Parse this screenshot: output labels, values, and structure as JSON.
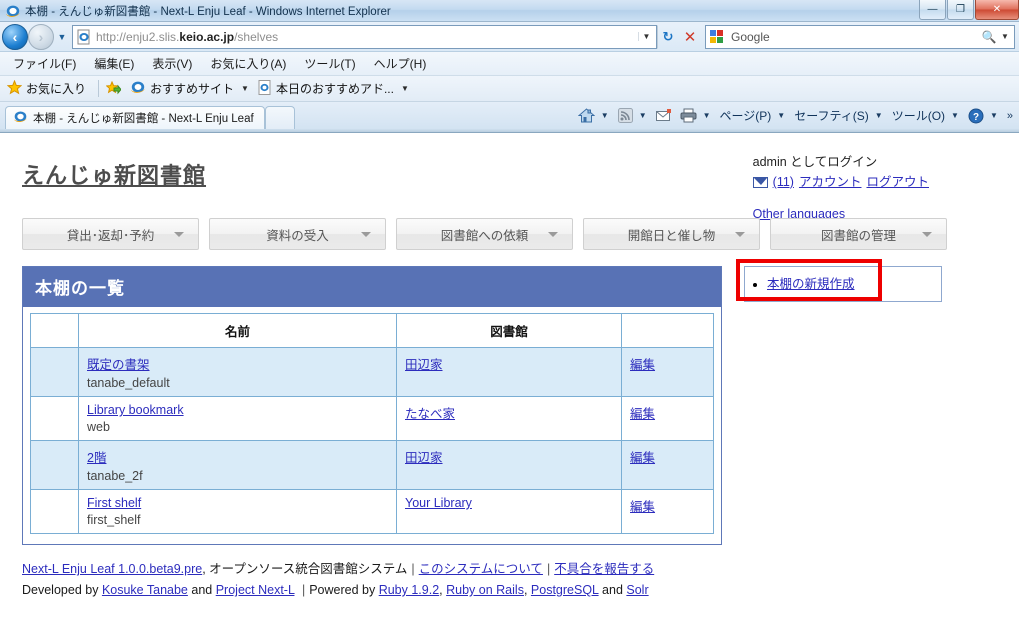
{
  "window": {
    "title": "本棚 - えんじゅ新図書館 - Next-L Enju Leaf - Windows Internet Explorer",
    "minimize_label": "—",
    "maximize_label": "❐",
    "close_label": "✕"
  },
  "address_bar": {
    "url_prefix": "http://enju2.slis.",
    "url_host_bold": "keio.ac.jp",
    "url_suffix": "/shelves",
    "dropdown_icon": "chevron-down-icon",
    "refresh_icon": "refresh-icon",
    "stop_icon": "stop-icon",
    "back_icon": "back-arrow-icon",
    "forward_icon": "forward-arrow-icon"
  },
  "search_bar": {
    "provider": "Google",
    "search_icon": "magnifier-icon",
    "dropdown_icon": "chevron-down-icon"
  },
  "menu_bar": {
    "items": [
      "ファイル(F)",
      "編集(E)",
      "表示(V)",
      "お気に入り(A)",
      "ツール(T)",
      "ヘルプ(H)"
    ]
  },
  "favorites_bar": {
    "favorites_label": "お気に入り",
    "items": [
      {
        "label": "おすすめサイト",
        "icon": "ie-logo-icon",
        "has_caret": true
      },
      {
        "label": "本日のおすすめアド...",
        "icon": "ie-page-icon",
        "has_caret": true
      }
    ]
  },
  "tabs": [
    {
      "label": "本棚 - えんじゅ新図書館 - Next-L Enju Leaf",
      "icon": "ie-logo-icon",
      "active": true
    },
    {
      "label": "",
      "icon": "new-tab-icon",
      "active": false
    }
  ],
  "command_bar": {
    "items": [
      {
        "label": "",
        "icon": "home-icon",
        "has_caret": true
      },
      {
        "label": "",
        "icon": "rss-feed-icon",
        "has_caret": true
      },
      {
        "label": "",
        "icon": "mail-read-icon",
        "has_caret": false
      },
      {
        "label": "",
        "icon": "printer-icon",
        "has_caret": true
      },
      {
        "label": "ページ(P)",
        "icon": "",
        "has_caret": true
      },
      {
        "label": "セーフティ(S)",
        "icon": "",
        "has_caret": true
      },
      {
        "label": "ツール(O)",
        "icon": "",
        "has_caret": true
      },
      {
        "label": "",
        "icon": "help-icon",
        "has_caret": true
      }
    ],
    "overflow_label": "»"
  },
  "page": {
    "site_title": "えんじゅ新図書館",
    "account": {
      "logged_in_text": "admin としてログイン",
      "message_icon": "envelope-icon",
      "message_count_label": "(11)",
      "account_label": "アカウント",
      "logout_label": "ログアウト",
      "other_languages_label": "Other languages"
    },
    "nav_buttons": [
      {
        "label": "貸出･返却･予約",
        "caret_icon": "triangle-down-icon"
      },
      {
        "label": "資料の受入",
        "caret_icon": "triangle-down-icon"
      },
      {
        "label": "図書館への依頼",
        "caret_icon": "triangle-down-icon"
      },
      {
        "label": "開館日と催し物",
        "caret_icon": "triangle-down-icon"
      },
      {
        "label": "図書館の管理",
        "caret_icon": "triangle-down-icon"
      }
    ],
    "panel": {
      "heading": "本棚の一覧",
      "table": {
        "columns": [
          "",
          "名前",
          "図書館",
          ""
        ],
        "rows": [
          {
            "name": "既定の書架",
            "sub": "tanabe_default",
            "library": "田辺家",
            "action": "編集"
          },
          {
            "name": "Library bookmark",
            "sub": "web",
            "library": "たなべ家",
            "action": "編集"
          },
          {
            "name": "2階",
            "sub": "tanabe_2f",
            "library": "田辺家",
            "action": "編集"
          },
          {
            "name": "First shelf",
            "sub": "first_shelf",
            "library": "Your Library",
            "action": "編集"
          }
        ]
      }
    },
    "sidebox": {
      "items": [
        {
          "label": "本棚の新規作成"
        }
      ],
      "highlight_color": "#ee0000"
    },
    "footer": {
      "line1": {
        "app_link": "Next-L Enju Leaf 1.0.0.beta9.pre",
        "desc": ", オープンソース統合図書館システム",
        "sep": "|",
        "about_link": "このシステムについて",
        "bug_link": "不具合を報告する"
      },
      "line2": {
        "developed_by": "Developed by",
        "dev1": "Kosuke Tanabe",
        "and1": "and",
        "dev2": "Project Next-L",
        "sep": "|",
        "powered_by": "Powered by",
        "tech1": "Ruby 1.9.2",
        "tech2": "Ruby on Rails",
        "tech3": "PostgreSQL",
        "and2": "and",
        "tech4": "Solr"
      }
    }
  },
  "colors": {
    "panel_header": "#5872b5",
    "panel_border": "#5e78b8",
    "table_border": "#7aaed4",
    "row_alt": "#d9ebf8",
    "link": "#2c2cbd",
    "highlight": "#ee0000"
  }
}
